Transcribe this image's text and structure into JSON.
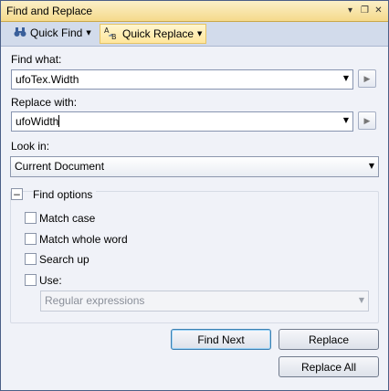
{
  "window": {
    "title": "Find and Replace",
    "title_buttons": [
      "▾",
      "❐",
      "✕"
    ]
  },
  "toolbar": {
    "quick_find": {
      "label": "Quick Find",
      "icon": "binoculars-icon"
    },
    "quick_replace": {
      "label": "Quick Replace",
      "icon": "replace-icon"
    }
  },
  "find": {
    "label": "Find what:",
    "value": "ufoTex.Width"
  },
  "replace": {
    "label": "Replace with:",
    "value": "ufoWidth"
  },
  "look_in": {
    "label": "Look in:",
    "value": "Current Document"
  },
  "options": {
    "title": "Find options",
    "collapse_symbol": "–",
    "match_case": {
      "label": "Match case",
      "checked": false
    },
    "match_whole_word": {
      "label": "Match whole word",
      "checked": false
    },
    "search_up": {
      "label": "Search up",
      "checked": false
    },
    "use": {
      "label": "Use:",
      "checked": false
    },
    "use_type": {
      "value": "Regular expressions"
    }
  },
  "buttons": {
    "find_next": "Find Next",
    "replace": "Replace",
    "replace_all": "Replace All"
  },
  "colors": {
    "accent": "#3c7fb1",
    "title_bar": "#f5da8b",
    "panel": "#f0f2f8"
  }
}
